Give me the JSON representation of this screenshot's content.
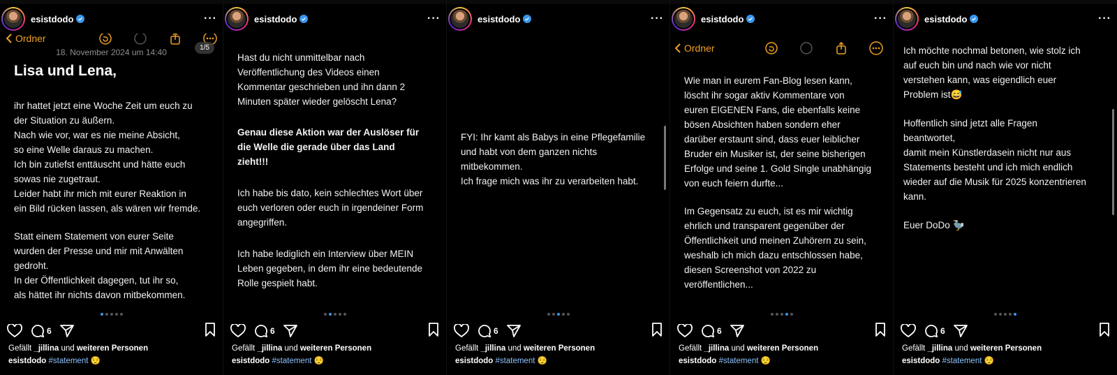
{
  "panels": [
    {
      "username": "esistdodo",
      "notes_back_label": "Ordner",
      "date": "18. November 2024 um 14:40",
      "counter": "1/5",
      "title": "Lisa und Lena,",
      "text_block_1": "ihr hattet jetzt eine Woche Zeit um euch zu\nder Situation zu äußern.\nNach wie vor, war es nie meine Absicht,\nso eine Welle daraus zu machen.\nIch bin zutiefst enttäuscht und hätte euch\nsowas nie zugetraut.\nLeider habt ihr mich mit eurer Reaktion in\nein Bild rücken lassen, als wären wir fremde.",
      "text_block_2": "Statt einem Statement von eurer Seite\nwurden der Presse und mir mit Anwälten\ngedroht.\nIn der Öffentlichkeit dagegen, tut ihr so,\nals hättet ihr nichts davon mitbekommen.",
      "comment_count": "6",
      "likes_prefix": "Gefällt",
      "likes_user": "_jillina",
      "likes_mid": "und",
      "likes_suffix": "weiteren Personen",
      "caption_user": "esistdodo",
      "hashtag": "#statement",
      "emoji": "😌"
    },
    {
      "username": "esistdodo",
      "text_block_1": "Hast du nicht unmittelbar nach\nVeröffentlichung des Videos einen\nKommentar geschrieben und ihn dann 2\nMinuten später wieder gelöscht Lena?",
      "bold_block": "Genau diese Aktion war der Auslöser für\ndie Welle die gerade über das Land\nzieht!!!",
      "text_block_2": "Ich habe bis dato, kein schlechtes Wort über\neuch verloren oder euch in irgendeiner Form\nangegriffen.",
      "text_block_3": "Ich habe lediglich ein Interview über MEIN\nLeben gegeben, in dem ihr eine bedeutende\nRolle gespielt habt.",
      "comment_count": "6",
      "likes_prefix": "Gefällt",
      "likes_user": "_jillina",
      "likes_mid": "und",
      "likes_suffix": "weiteren Personen",
      "caption_user": "esistdodo",
      "hashtag": "#statement",
      "emoji": "😌"
    },
    {
      "username": "esistdodo",
      "text_block_1": "FYI: Ihr kamt als Babys in eine Pflegefamilie\nund habt von dem ganzen nichts\nmitbekommen.\nIch frage mich was ihr zu verarbeiten habt.",
      "comment_count": "6",
      "likes_prefix": "Gefällt",
      "likes_user": "_jillina",
      "likes_mid": "und",
      "likes_suffix": "weiteren Personen",
      "caption_user": "esistdodo",
      "hashtag": "#statement",
      "emoji": "😌"
    },
    {
      "username": "esistdodo",
      "notes_back_label": "Ordner",
      "text_block_1": "Wie man in eurem Fan-Blog lesen kann,\nlöscht ihr sogar aktiv Kommentare von\neuren EIGENEN Fans, die ebenfalls keine\nbösen Absichten haben sondern eher\ndarüber erstaunt sind, dass euer leiblicher\nBruder ein Musiker ist, der seine bisherigen\nErfolge und seine 1. Gold Single unabhängig\nvon euch feiern durfte...",
      "text_block_2": "Im Gegensatz zu euch, ist es mir wichtig\nehrlich und transparent gegenüber der\nÖffentlichkeit und meinen Zuhörern zu sein,\nweshalb ich mich dazu entschlossen habe,\ndiesen Screenshot von 2022 zu\nveröffentlichen...",
      "comment_count": "6",
      "likes_prefix": "Gefällt",
      "likes_user": "_jillina",
      "likes_mid": "und",
      "likes_suffix": "weiteren Personen",
      "caption_user": "esistdodo",
      "hashtag": "#statement",
      "emoji": "😌"
    },
    {
      "username": "esistdodo",
      "text_block_1": "Ich möchte nochmal betonen, wie stolz ich\nauf euch bin und nach wie vor nicht\nverstehen kann, was eigendlich euer\nProblem ist😅",
      "text_block_2": "Hoffentlich sind jetzt alle Fragen\nbeantwortet,\ndamit mein Künstlerdasein nicht nur aus\nStatements besteht und ich mich endlich\nwieder auf die Musik für 2025 konzentrieren\nkann.",
      "text_block_3": "Euer DoDo 🦤",
      "comment_count": "6",
      "likes_prefix": "Gefällt",
      "likes_user": "_jillina",
      "likes_mid": "und",
      "likes_suffix": "weiteren Personen",
      "caption_user": "esistdodo",
      "hashtag": "#statement",
      "emoji": "😌"
    }
  ],
  "colors": {
    "background": "#000000",
    "notes_accent": "#f0a020",
    "verified": "#3897f0",
    "hashtag": "#8fc3ff",
    "dot_active": "#3897f0"
  },
  "icons": [
    "avatar",
    "verified-icon",
    "more-icon",
    "back-chevron-icon",
    "undo-icon",
    "redo-icon",
    "share-icon",
    "heart-icon",
    "comment-icon",
    "send-icon",
    "bookmark-icon"
  ]
}
